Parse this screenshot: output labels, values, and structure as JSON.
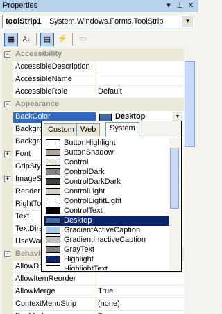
{
  "window": {
    "title": "Properties",
    "pin_glyph": "▾",
    "autohide_glyph": "⊥",
    "close_glyph": "✕"
  },
  "object_selector": {
    "name": "toolStrip1",
    "type": "System.Windows.Forms.ToolStrip",
    "dropdown_glyph": "▼"
  },
  "toolbar": {
    "categorized_glyph": "▦",
    "alphabetical_glyph": "A↓",
    "properties_glyph": "▤",
    "events_glyph": "⚡",
    "pages_glyph": "▭"
  },
  "rows": [
    {
      "type": "category",
      "name": "Accessibility",
      "expander": "−"
    },
    {
      "type": "prop",
      "name": "AccessibleDescription",
      "value": ""
    },
    {
      "type": "prop",
      "name": "AccessibleName",
      "value": ""
    },
    {
      "type": "prop",
      "name": "AccessibleRole",
      "value": "Default"
    },
    {
      "type": "category",
      "name": "Appearance",
      "expander": "−"
    },
    {
      "type": "selected",
      "name": "BackColor",
      "value": "Desktop"
    },
    {
      "type": "prop",
      "name": "BackgroundImage",
      "value": ""
    },
    {
      "type": "prop",
      "name": "BackgroundImageLayout",
      "value": ""
    },
    {
      "type": "prop",
      "name": "Font",
      "value": "",
      "expander": "+"
    },
    {
      "type": "prop",
      "name": "GripStyle",
      "value": ""
    },
    {
      "type": "prop",
      "name": "ImageScalingSize",
      "value": "",
      "expander": "+"
    },
    {
      "type": "prop",
      "name": "RenderMode",
      "value": ""
    },
    {
      "type": "prop",
      "name": "RightToLeft",
      "value": ""
    },
    {
      "type": "prop",
      "name": "Text",
      "value": ""
    },
    {
      "type": "prop",
      "name": "TextDirection",
      "value": ""
    },
    {
      "type": "prop",
      "name": "UseWaitCursor",
      "value": ""
    },
    {
      "type": "category",
      "name": "Behavior",
      "expander": "−"
    },
    {
      "type": "prop",
      "name": "AllowDrop",
      "value": ""
    },
    {
      "type": "prop",
      "name": "AllowItemReorder",
      "value": ""
    },
    {
      "type": "prop",
      "name": "AllowMerge",
      "value": "True"
    },
    {
      "type": "prop",
      "name": "ContextMenuStrip",
      "value": "(none)"
    },
    {
      "type": "prop",
      "name": "Enabled",
      "value": "True"
    }
  ],
  "backcolor_swatch": "#3a6ea5",
  "dropdown_glyph": "▼",
  "color_picker": {
    "tabs": [
      "Custom",
      "Web",
      "System"
    ],
    "active_tab": "System",
    "items": [
      {
        "name": "ButtonHighlight",
        "color": "#ffffff"
      },
      {
        "name": "ButtonShadow",
        "color": "#aca899"
      },
      {
        "name": "Control",
        "color": "#ece9d8"
      },
      {
        "name": "ControlDark",
        "color": "#808080"
      },
      {
        "name": "ControlDarkDark",
        "color": "#404040"
      },
      {
        "name": "ControlLight",
        "color": "#d4d0c8"
      },
      {
        "name": "ControlLightLight",
        "color": "#ffffff"
      },
      {
        "name": "ControlText",
        "color": "#000000"
      },
      {
        "name": "Desktop",
        "color": "#3a6ea5"
      },
      {
        "name": "GradientActiveCaption",
        "color": "#a6caf0"
      },
      {
        "name": "GradientInactiveCaption",
        "color": "#c0c0c0"
      },
      {
        "name": "GrayText",
        "color": "#808080"
      },
      {
        "name": "Highlight",
        "color": "#0a246a"
      },
      {
        "name": "HighlightText",
        "color": "#ffffff"
      }
    ],
    "selected": "Desktop"
  }
}
